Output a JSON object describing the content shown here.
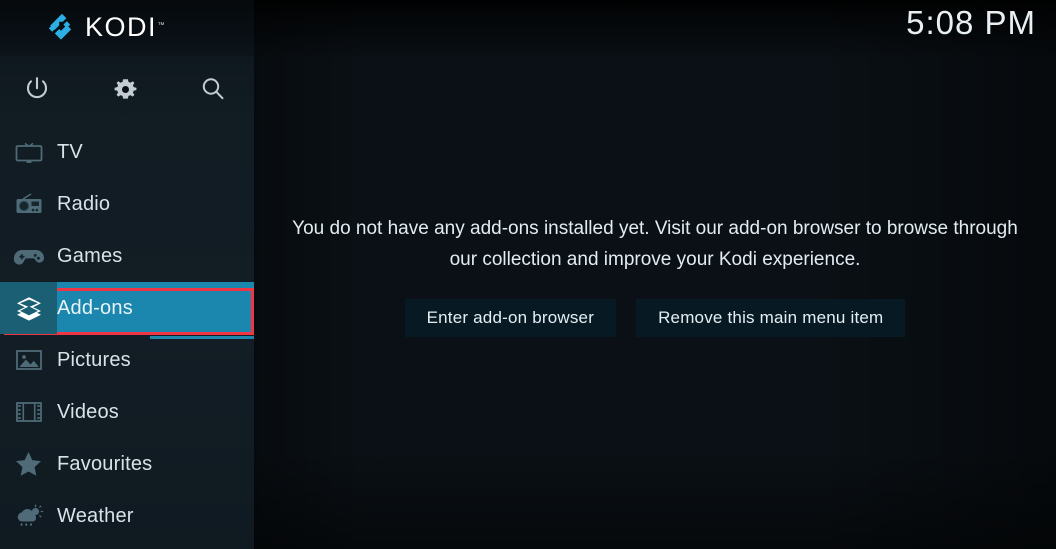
{
  "app": {
    "name": "KODI",
    "logo_icon": "kodi-logo-icon",
    "trademark": "™"
  },
  "header": {
    "clock": "5:08 PM"
  },
  "system_icons": [
    {
      "name": "power-icon",
      "label": "Power"
    },
    {
      "name": "gear-icon",
      "label": "Settings"
    },
    {
      "name": "search-icon",
      "label": "Search"
    }
  ],
  "sidebar": {
    "items": [
      {
        "label": "TV",
        "icon": "tv-icon",
        "selected": false
      },
      {
        "label": "Radio",
        "icon": "radio-icon",
        "selected": false
      },
      {
        "label": "Games",
        "icon": "gamepad-icon",
        "selected": false
      },
      {
        "label": "Add-ons",
        "icon": "addons-box-icon",
        "selected": true
      },
      {
        "label": "Pictures",
        "icon": "pictures-icon",
        "selected": false
      },
      {
        "label": "Videos",
        "icon": "film-strip-icon",
        "selected": false
      },
      {
        "label": "Favourites",
        "icon": "star-icon",
        "selected": false
      },
      {
        "label": "Weather",
        "icon": "weather-icon",
        "selected": false
      }
    ]
  },
  "main": {
    "message": "You do not have any add-ons installed yet. Visit our add-on browser to browse through our collection and improve your Kodi experience.",
    "buttons": [
      {
        "label": "Enter add-on browser"
      },
      {
        "label": "Remove this main menu item"
      }
    ]
  },
  "colors": {
    "accent_highlight": "#1b87ae",
    "accent_icon_bg": "#1b5f75",
    "annotation_red": "#f03545",
    "sidebar_bg": "#111c23",
    "logo_blue": "#2daee4"
  }
}
